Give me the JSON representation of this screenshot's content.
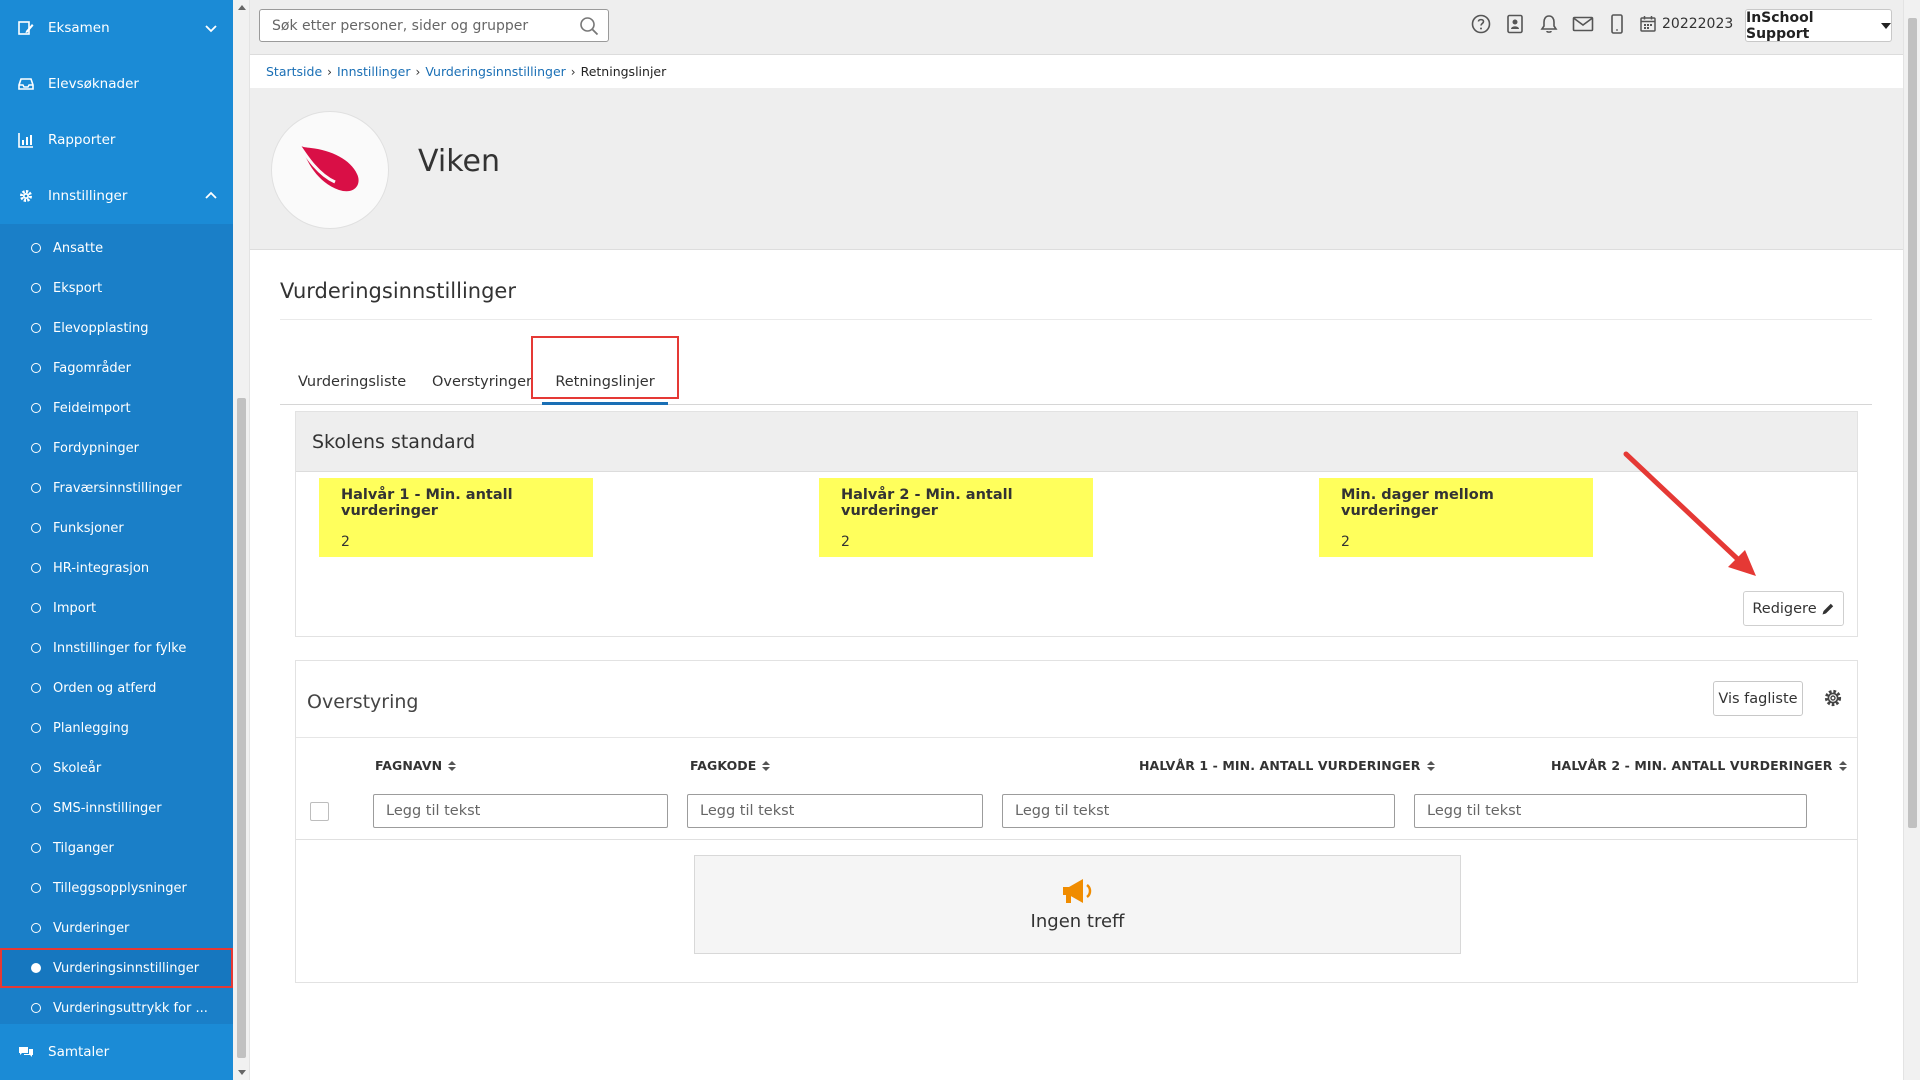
{
  "sidebar": {
    "top_items": [
      {
        "label": "Eksamen",
        "icon": "exam-icon"
      },
      {
        "label": "Elevsøknader",
        "icon": "inbox-icon"
      },
      {
        "label": "Rapporter",
        "icon": "chart-icon"
      }
    ],
    "settings": {
      "label": "Innstillinger",
      "icon": "gear-icon"
    },
    "sub_items": [
      {
        "label": "Ansatte"
      },
      {
        "label": "Eksport"
      },
      {
        "label": "Elevopplasting"
      },
      {
        "label": "Fagområder"
      },
      {
        "label": "Feideimport"
      },
      {
        "label": "Fordypninger"
      },
      {
        "label": "Fraværsinnstillinger"
      },
      {
        "label": "Funksjoner"
      },
      {
        "label": "HR-integrasjon"
      },
      {
        "label": "Import"
      },
      {
        "label": "Innstillinger for fylke"
      },
      {
        "label": "Orden og atferd"
      },
      {
        "label": "Planlegging"
      },
      {
        "label": "Skoleår"
      },
      {
        "label": "SMS-innstillinger"
      },
      {
        "label": "Tilganger"
      },
      {
        "label": "Tilleggsopplysninger"
      },
      {
        "label": "Vurderinger"
      },
      {
        "label": "Vurderingsinnstillinger",
        "active": true
      },
      {
        "label": "Vurderingsuttrykk for ..."
      }
    ],
    "bottom_item": {
      "label": "Samtaler",
      "icon": "chat-icon"
    }
  },
  "topbar": {
    "search_placeholder": "Søk etter personer, sider og grupper",
    "school_year": "20222023",
    "user_menu": "InSchool Support"
  },
  "breadcrumb": {
    "items": [
      "Startside",
      "Innstillinger",
      "Vurderingsinnstillinger"
    ],
    "current": "Retningslinjer"
  },
  "hero": {
    "name": "Viken"
  },
  "page": {
    "title": "Vurderingsinnstillinger",
    "tabs": [
      {
        "label": "Vurderingsliste"
      },
      {
        "label": "Overstyringer"
      },
      {
        "label": "Retningslinjer",
        "active": true
      }
    ]
  },
  "standard": {
    "title": "Skolens standard",
    "stats": [
      {
        "label": "Halvår 1 - Min. antall vurderinger",
        "value": "2"
      },
      {
        "label": "Halvår 2 - Min. antall vurderinger",
        "value": "2"
      },
      {
        "label": "Min. dager mellom vurderinger",
        "value": "2"
      }
    ],
    "edit_label": "Redigere"
  },
  "override": {
    "title": "Overstyring",
    "show_subjects_label": "Vis fagliste",
    "columns": [
      {
        "label": "FAGNAVN",
        "placeholder": "Legg til tekst"
      },
      {
        "label": "FAGKODE",
        "placeholder": "Legg til tekst"
      },
      {
        "label": "HALVÅR 1 - MIN. ANTALL VURDERINGER",
        "placeholder": "Legg til tekst"
      },
      {
        "label": "HALVÅR 2 - MIN. ANTALL VURDERINGER",
        "placeholder": "Legg til tekst"
      }
    ],
    "empty_text": "Ingen treff"
  },
  "colors": {
    "sidebar": "#1a7fc8",
    "highlight": "#ffff5c",
    "annotation": "#e53935",
    "link": "#1a6fb5",
    "empty_icon": "#f08c00"
  }
}
